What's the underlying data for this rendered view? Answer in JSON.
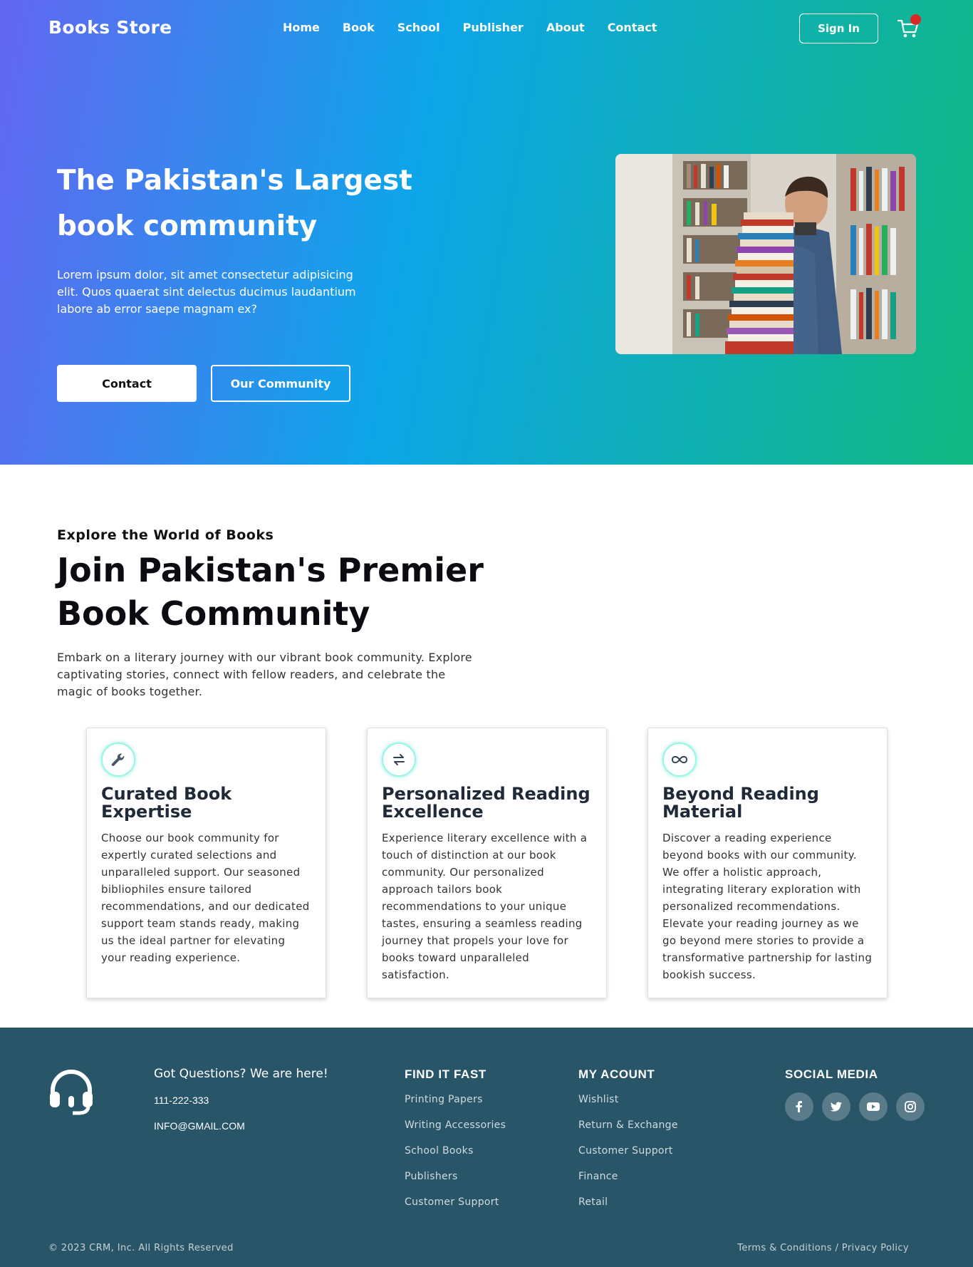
{
  "header": {
    "brand": "Books Store",
    "nav": [
      "Home",
      "Book",
      "School",
      "Publisher",
      "About",
      "Contact"
    ],
    "signin_label": "Sign In"
  },
  "hero": {
    "title": "The Pakistan's Largest book community",
    "text": "Lorem ipsum dolor, sit amet consectetur adipisicing elit. Quos quaerat sint delectus ducimus laudantium labore ab error saepe magnam ex?",
    "contact_label": "Contact",
    "community_label": "Our Community"
  },
  "about": {
    "eyebrow": "Explore the World of Books",
    "title": "Join Pakistan's Premier Book Community",
    "text": "Embark on a literary journey with our vibrant book community. Explore captivating stories, connect with fellow readers, and celebrate the magic of books together."
  },
  "cards": [
    {
      "icon": "wrench-icon",
      "title": "Curated Book Expertise",
      "text": "Choose our book community for expertly curated selections and unparalleled support. Our seasoned bibliophiles ensure tailored recommendations, and our dedicated support team stands ready, making us the ideal partner for elevating your reading experience."
    },
    {
      "icon": "exchange-icon",
      "title": "Personalized Reading Excellence",
      "text": "Experience literary excellence with a touch of distinction at our book community. Our personalized approach tailors book recommendations to your unique tastes, ensuring a seamless reading journey that propels your love for books toward unparalleled satisfaction."
    },
    {
      "icon": "infinity-icon",
      "title": "Beyond Reading Material",
      "text": "Discover a reading experience beyond books with our community. We offer a holistic approach, integrating literary exploration with personalized recommendations. Elevate your reading journey as we go beyond mere stories to provide a transformative partnership for lasting bookish success."
    }
  ],
  "footer": {
    "questions": "Got Questions? We are here!",
    "phone": "111-222-333",
    "email": "INFO@GMAIL.COM",
    "find_title": "FIND IT FAST",
    "find_links": [
      "Printing Papers",
      "Writing Accessories",
      "School Books",
      "Publishers",
      "Customer Support"
    ],
    "account_title": "MY ACOUNT",
    "account_links": [
      "Wishlist",
      "Return & Exchange",
      "Customer Support",
      "Finance",
      "Retail"
    ],
    "social_title": "SOCIAL MEDIA",
    "social_icons": [
      "facebook-icon",
      "twitter-icon",
      "youtube-icon",
      "instagram-icon"
    ],
    "copyright": "© 2023 CRM, Inc. All Rights Reserved",
    "legal": "Terms & Conditions / Privacy Policy"
  },
  "colors": {
    "gradient_start": "#6366f1",
    "gradient_mid": "#0ea5e9",
    "gradient_end": "#10b981",
    "footer_bg": "#285568",
    "cart_badge": "#dc2626"
  }
}
